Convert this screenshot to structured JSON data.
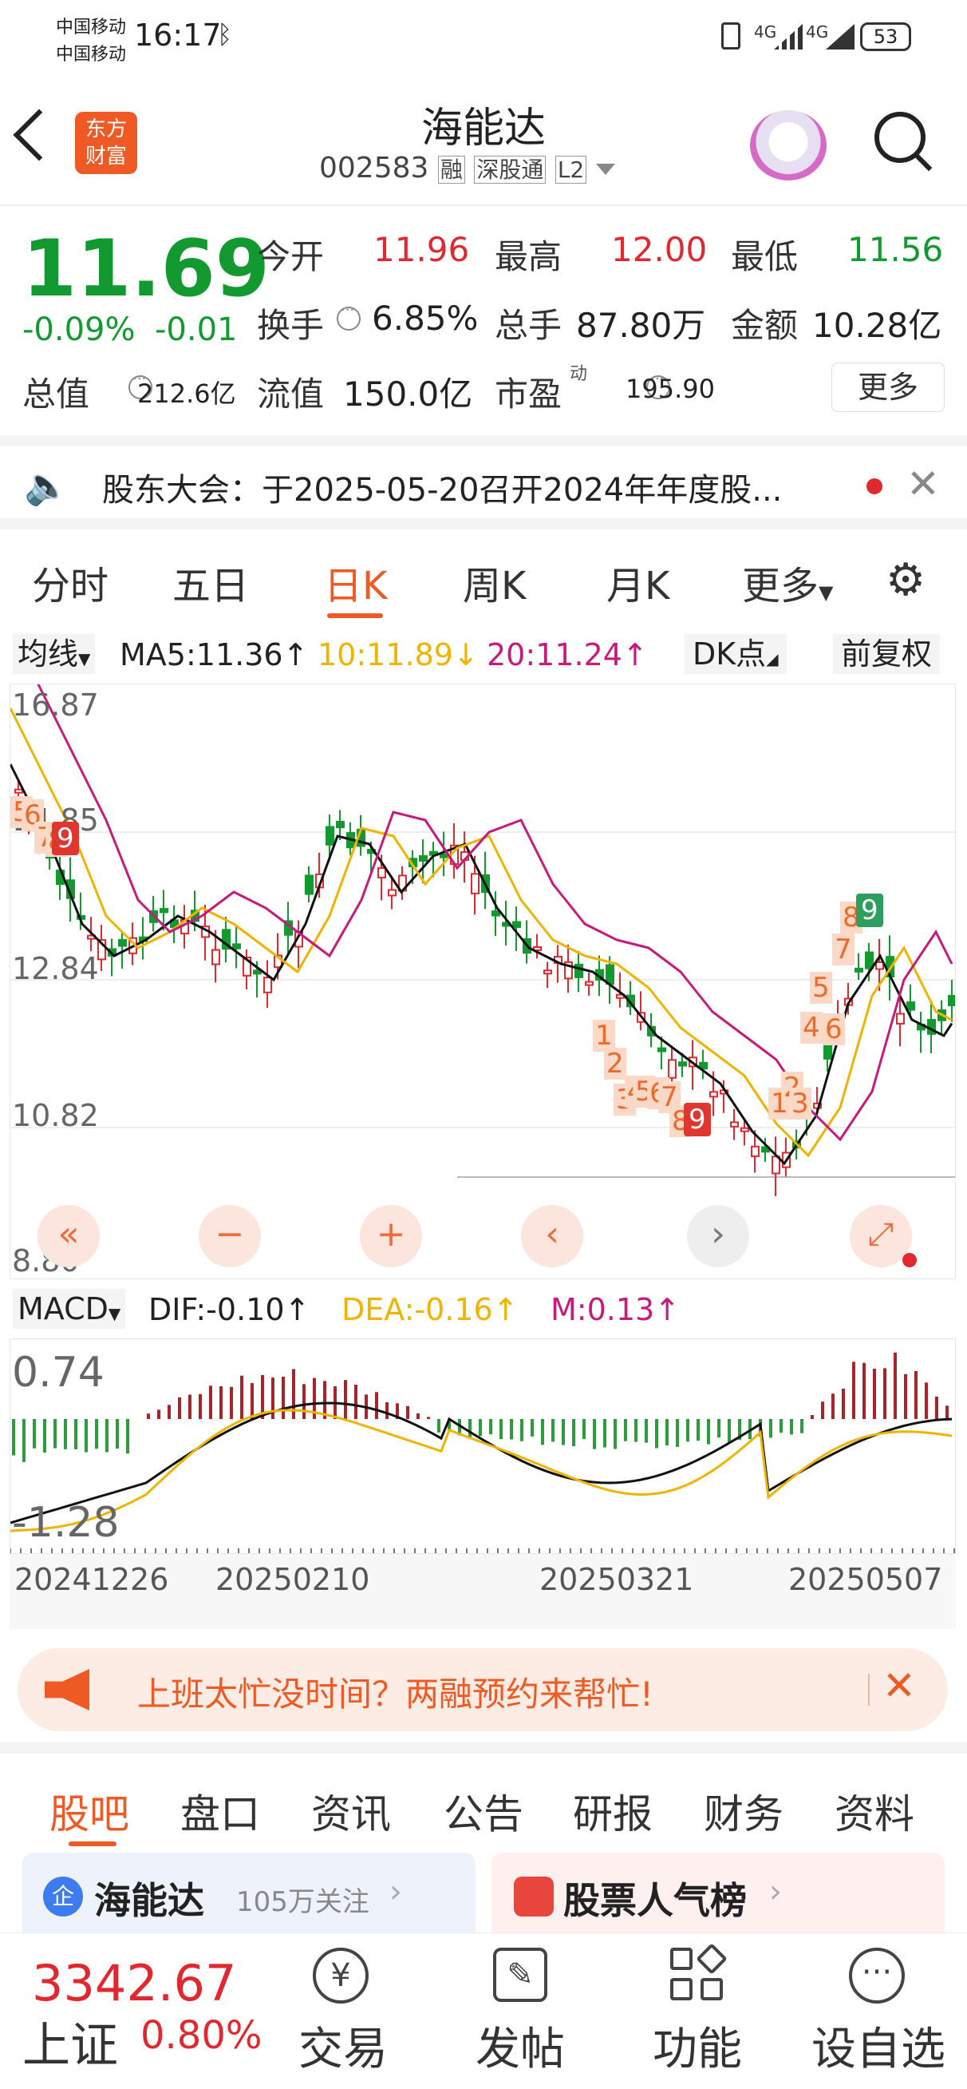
{
  "status_bar": {
    "carrier1": "中国移动",
    "carrier2": "中国移动",
    "time": "16:17",
    "bluetooth_icon": "bluetooth-icon",
    "net1": "4G",
    "net2": "4G",
    "battery": "53"
  },
  "header": {
    "logo_line1": "东方",
    "logo_line2": "财富",
    "title": "海能达",
    "code": "002583",
    "badges": [
      "融",
      "深股通",
      "L2"
    ]
  },
  "quote": {
    "price": "11.69",
    "pct": "-0.09%",
    "chg": "-0.01",
    "open_label": "今开",
    "open": "11.96",
    "high_label": "最高",
    "high": "12.00",
    "low_label": "最低",
    "low": "11.56",
    "turnover_label": "换手",
    "turnover": "6.85%",
    "volume_label": "总手",
    "volume": "87.80万",
    "amount_label": "金额",
    "amount": "10.28亿",
    "mktcap_label": "总值",
    "mktcap": "212.6亿",
    "float_label": "流值",
    "float": "150.0亿",
    "pe_label": "市盈",
    "pe_sup": "动",
    "pe": "195.90",
    "more": "更多"
  },
  "notice": {
    "text": "股东大会：于2025-05-20召开2024年年度股..."
  },
  "period_tabs": [
    "分时",
    "五日",
    "日K",
    "周K",
    "月K",
    "更多"
  ],
  "active_tab": "日K",
  "kline": {
    "ma_select": "均线",
    "ma5": "MA5:11.36↑",
    "ma10": "10:11.89↓",
    "ma20": "20:11.24↑",
    "dk": "DK点",
    "adjust": "前复权",
    "y_labels": [
      "16.87",
      "14.85",
      "12.84",
      "10.82",
      "8.80"
    ],
    "buttons": [
      "«",
      "−",
      "+",
      "‹",
      "›"
    ],
    "markers": [
      {
        "t": "5",
        "k": "m"
      },
      {
        "t": "6",
        "k": "m"
      },
      {
        "t": "7",
        "k": "m"
      },
      {
        "t": "8",
        "k": "m"
      },
      {
        "t": "9",
        "k": "r"
      },
      {
        "t": "1",
        "k": "m"
      },
      {
        "t": "2",
        "k": "m"
      },
      {
        "t": "3",
        "k": "m"
      },
      {
        "t": "4",
        "k": "m"
      },
      {
        "t": "5",
        "k": "m"
      },
      {
        "t": "6",
        "k": "m"
      },
      {
        "t": "7",
        "k": "m"
      },
      {
        "t": "8",
        "k": "m"
      },
      {
        "t": "9",
        "k": "r"
      },
      {
        "t": "1",
        "k": "m"
      },
      {
        "t": "2",
        "k": "m"
      },
      {
        "t": "3",
        "k": "m"
      },
      {
        "t": "4",
        "k": "m"
      },
      {
        "t": "6",
        "k": "m"
      },
      {
        "t": "5",
        "k": "m"
      },
      {
        "t": "7",
        "k": "m"
      },
      {
        "t": "8",
        "k": "m"
      },
      {
        "t": "9",
        "k": "g"
      }
    ]
  },
  "macd": {
    "select": "MACD",
    "dif": "DIF:-0.10↑",
    "dea": "DEA:-0.16↑",
    "m": "M:0.13↑",
    "y_top": "0.74",
    "y_bottom": "-1.28"
  },
  "dates": [
    "20241226",
    "20250210",
    "20250321",
    "20250507"
  ],
  "promo": {
    "text": "上班太忙没时间？两融预约来帮忙!"
  },
  "section_tabs": [
    "股吧",
    "盘口",
    "资讯",
    "公告",
    "研报",
    "财务",
    "资料"
  ],
  "cards": {
    "left_name": "海能达",
    "left_follow": "105万关注",
    "right_name": "股票人气榜"
  },
  "bottom": {
    "index_value": "3342.67",
    "index_name": "上证",
    "index_pct": "0.80%",
    "items": [
      "交易",
      "发帖",
      "功能",
      "设自选"
    ]
  },
  "colors": {
    "up": "#e0282e",
    "down": "#129a31",
    "accent": "#ef6b3b",
    "ma10": "#f0b400",
    "ma20": "#c81a7d"
  }
}
